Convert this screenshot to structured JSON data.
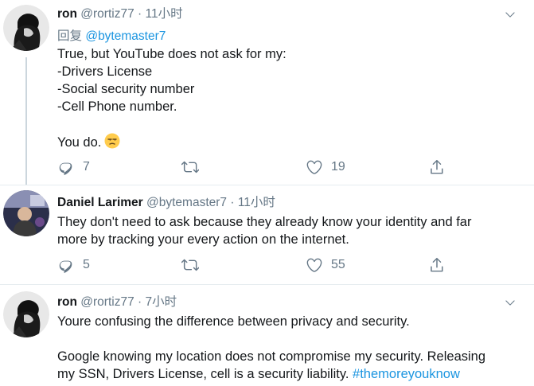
{
  "tweets": [
    {
      "name": "ron",
      "handle": "@rortiz77",
      "time": "11小时",
      "reply_prefix": "回复",
      "reply_to": "@bytemaster7",
      "lines": [
        "True, but YouTube does not ask for my:",
        "-Drivers License",
        "-Social security number",
        "-Cell Phone number.",
        "",
        "You do."
      ],
      "emoji": "unamused-face-emoji",
      "replies": "7",
      "retweets": "",
      "likes": "19"
    },
    {
      "name": "Daniel Larimer",
      "handle": "@bytemaster7",
      "time": "11小时",
      "lines": [
        "They don't need to ask because they already know your identity and far",
        "more by tracking your every action on the internet."
      ],
      "replies": "5",
      "retweets": "",
      "likes": "55"
    },
    {
      "name": "ron",
      "handle": "@rortiz77",
      "time": "7小时",
      "lines": [
        "Youre confusing the difference between privacy and security.",
        "",
        "Google knowing my location does not compromise my security. Releasing"
      ],
      "last_line_text": "my SSN, Drivers License, cell is a security liability. ",
      "hashtag": "#themoreyouknow"
    }
  ],
  "separator": " · ",
  "colors": {
    "link": "#1b95e0",
    "secondary": "#657786",
    "divider": "#e6ecf0",
    "thread": "#ccd6dd"
  },
  "icons": [
    "chevron-down-icon",
    "reply-icon",
    "retweet-icon",
    "like-icon",
    "share-icon"
  ]
}
